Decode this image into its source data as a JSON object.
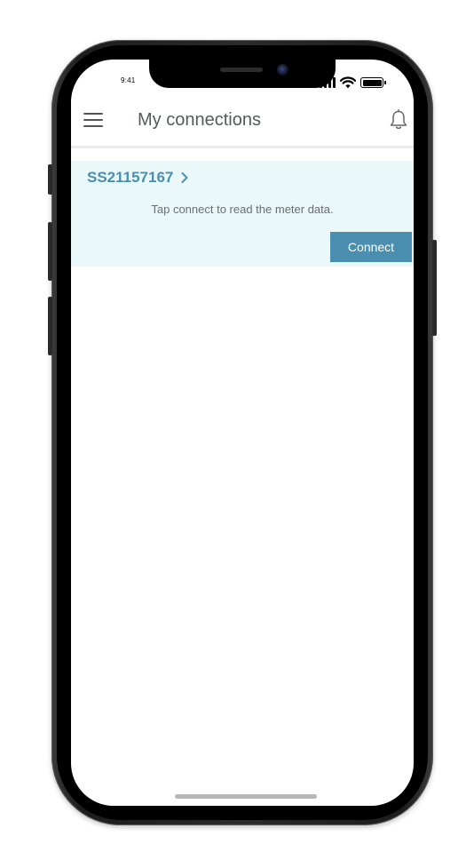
{
  "status_bar": {
    "time": "9:41",
    "signal_bars": 4,
    "wifi_icon": "wifi-icon",
    "battery_level": 1.0
  },
  "header": {
    "title": "My connections",
    "menu_icon": "hamburger-menu-icon",
    "notification_icon": "bell-icon"
  },
  "connection": {
    "meter_id": "SS21157167",
    "chevron_icon": "chevron-right-icon",
    "hint": "Tap connect to read the meter data.",
    "connect_label": "Connect"
  },
  "colors": {
    "accent": "#4a8fb0",
    "card_background": "#ebf8fa",
    "title_text": "#555a5e",
    "hint_text": "#6a6d70"
  }
}
